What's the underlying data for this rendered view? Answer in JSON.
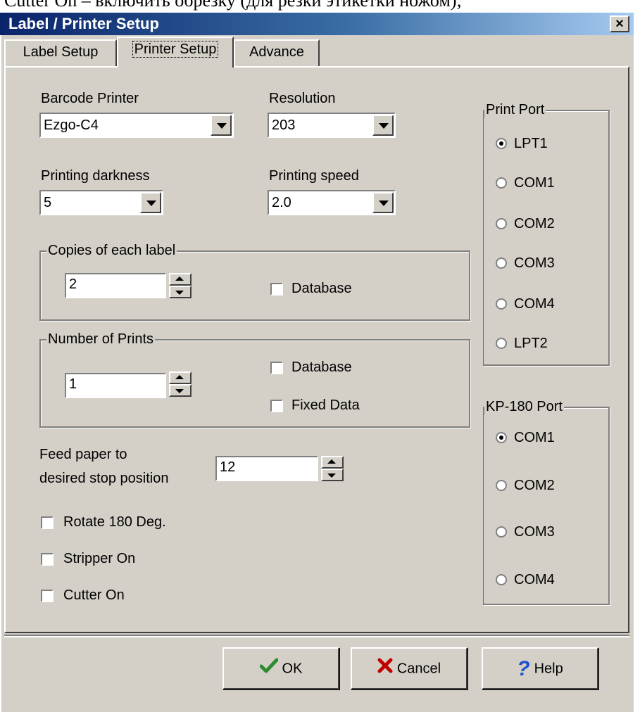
{
  "top_caption": "Cutter On – включить обрезку (для резки этикетки ножом);",
  "window": {
    "title": "Label / Printer Setup",
    "close_label": "×"
  },
  "tabs": [
    {
      "label": "Label Setup"
    },
    {
      "label": "Printer Setup"
    },
    {
      "label": "Advance"
    }
  ],
  "active_tab": "Printer Setup",
  "fields": {
    "barcode_printer": {
      "label": "Barcode Printer",
      "value": "Ezgo-C4"
    },
    "resolution": {
      "label": "Resolution",
      "value": "203"
    },
    "printing_darkness": {
      "label": "Printing darkness",
      "value": "5"
    },
    "printing_speed": {
      "label": "Printing speed",
      "value": "2.0"
    }
  },
  "copies_group": {
    "title": "Copies of each label",
    "value": "2",
    "database_label": "Database",
    "database_checked": false
  },
  "prints_group": {
    "title": "Number of Prints",
    "value": "1",
    "database_label": "Database",
    "database_checked": false,
    "fixed_label": "Fixed Data",
    "fixed_checked": false
  },
  "feed": {
    "label_line1": "Feed paper to",
    "label_line2": "desired stop position",
    "value": "12"
  },
  "options": [
    {
      "label": "Rotate 180 Deg.",
      "checked": false
    },
    {
      "label": "Stripper On",
      "checked": false
    },
    {
      "label": "Cutter On",
      "checked": false
    }
  ],
  "print_port": {
    "title": "Print Port",
    "options": [
      "LPT1",
      "COM1",
      "COM2",
      "COM3",
      "COM4",
      "LPT2"
    ],
    "selected": "LPT1"
  },
  "kp_port": {
    "title": "KP-180 Port",
    "options": [
      "COM1",
      "COM2",
      "COM3",
      "COM4"
    ],
    "selected": "COM1"
  },
  "buttons": {
    "ok": "OK",
    "cancel": "Cancel",
    "help": "Help"
  },
  "icons": {
    "ok": "checkmark-icon",
    "cancel": "x-mark-icon",
    "help": "question-mark-icon",
    "ok_color": "#2e8b2e",
    "cancel_color": "#c00000",
    "help_color": "#1a4fd0"
  }
}
